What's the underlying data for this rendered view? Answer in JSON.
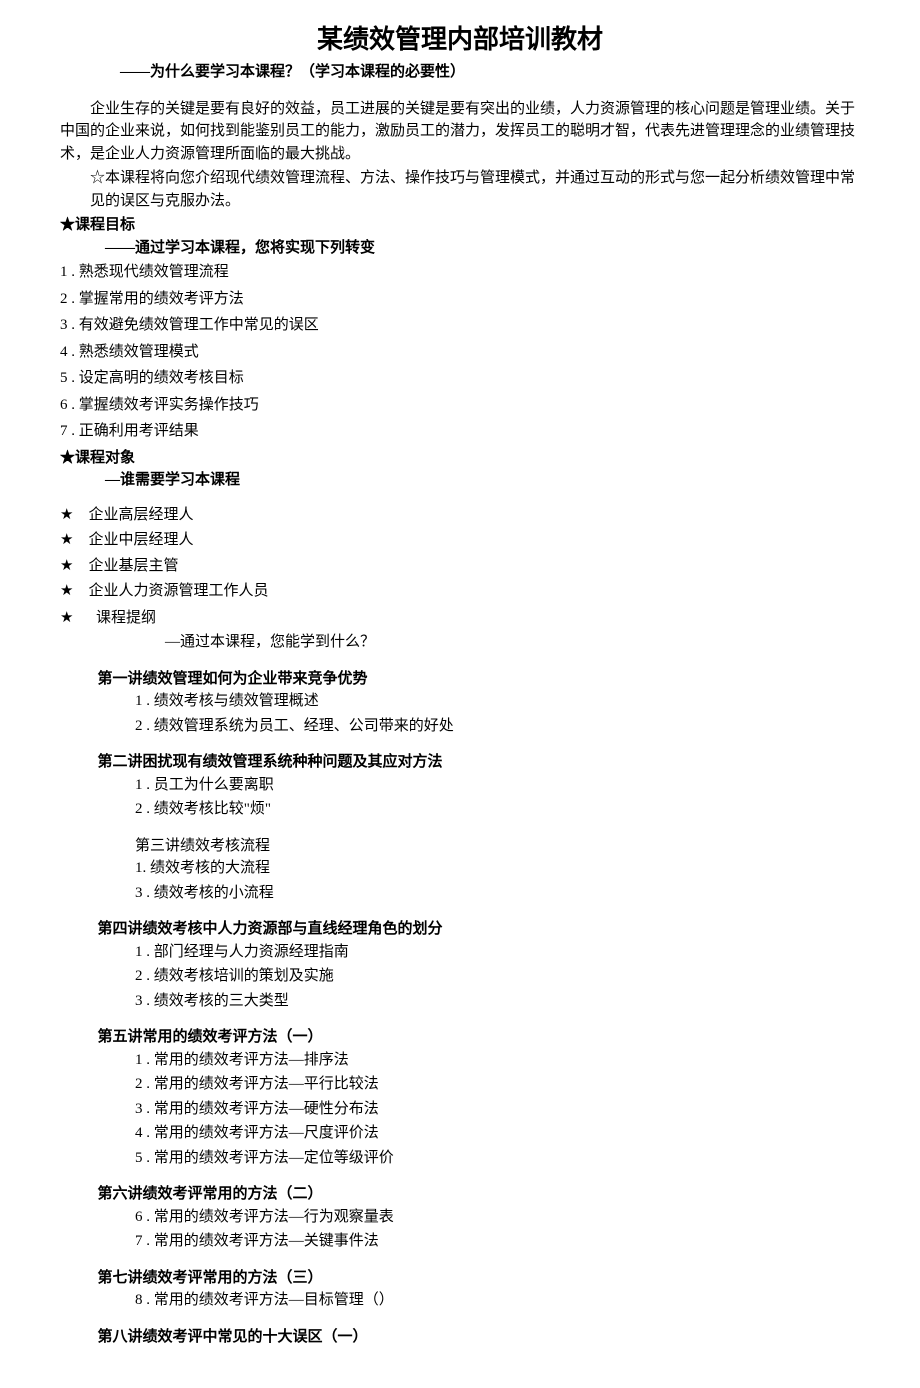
{
  "title": "某绩效管理内部培训教材",
  "subtitle": "——为什么要学习本课程？（学习本课程的必要性）",
  "intro_p1": "企业生存的关键是要有良好的效益，员工进展的关键是要有突出的业绩，人力资源管理的核心问题是管理业绩。关于中国的企业来说，如何找到能鉴别员工的能力，激励员工的潜力，发挥员工的聪明才智，代表先进管理理念的业绩管理技术，是企业人力资源管理所面临的最大挑战。",
  "intro_p2": "☆本课程将向您介绍现代绩效管理流程、方法、操作技巧与管理模式，并通过互动的形式与您一起分析绩效管理中常见的误区与克服办法。",
  "goal_header": "★课程目标",
  "goal_sub": "——通过学习本课程，您将实现下列转变",
  "goals": [
    "1 . 熟悉现代绩效管理流程",
    "2 . 掌握常用的绩效考评方法",
    "3 . 有效避免绩效管理工作中常见的误区",
    "4 . 熟悉绩效管理模式",
    "5 . 设定高明的绩效考核目标",
    "6 . 掌握绩效考评实务操作技巧",
    "7 . 正确利用考评结果"
  ],
  "audience_header": "★课程对象",
  "audience_sub": "—谁需要学习本课程",
  "audience": [
    "企业高层经理人",
    "企业中层经理人",
    "企业基层主管",
    "企业人力资源管理工作人员"
  ],
  "outline_header": "课程提纲",
  "outline_sub": "—通过本课程，您能学到什么？",
  "lectures": [
    {
      "title": "第一讲绩效管理如何为企业带来竞争优势",
      "bold": true,
      "items": [
        "1 . 绩效考核与绩效管理概述",
        "2 . 绩效管理系统为员工、经理、公司带来的好处"
      ]
    },
    {
      "title": "第二讲困扰现有绩效管理系统种种问题及其应对方法",
      "bold": true,
      "items": [
        "1 . 员工为什么要离职",
        "2 . 绩效考核比较\"烦\""
      ]
    },
    {
      "title": "第三讲绩效考核流程",
      "bold": false,
      "items": [
        "1. 绩效考核的大流程",
        "3 . 绩效考核的小流程"
      ]
    },
    {
      "title": "第四讲绩效考核中人力资源部与直线经理角色的划分",
      "bold": true,
      "items": [
        "1 . 部门经理与人力资源经理指南",
        "2 . 绩效考核培训的策划及实施",
        "3 . 绩效考核的三大类型"
      ]
    },
    {
      "title": "第五讲常用的绩效考评方法（一）",
      "bold": true,
      "items": [
        "1 . 常用的绩效考评方法—排序法",
        "2 . 常用的绩效考评方法—平行比较法",
        "3 . 常用的绩效考评方法—硬性分布法",
        "4 . 常用的绩效考评方法—尺度评价法",
        "5 . 常用的绩效考评方法—定位等级评价"
      ]
    },
    {
      "title": "第六讲绩效考评常用的方法（二）",
      "bold": true,
      "items": [
        "6 . 常用的绩效考评方法—行为观察量表",
        "7 . 常用的绩效考评方法—关键事件法"
      ]
    },
    {
      "title": "第七讲绩效考评常用的方法（三）",
      "bold": true,
      "items": [
        "8 . 常用的绩效考评方法—目标管理（）"
      ]
    },
    {
      "title": "第八讲绩效考评中常见的十大误区（一）",
      "bold": true,
      "items": []
    }
  ]
}
